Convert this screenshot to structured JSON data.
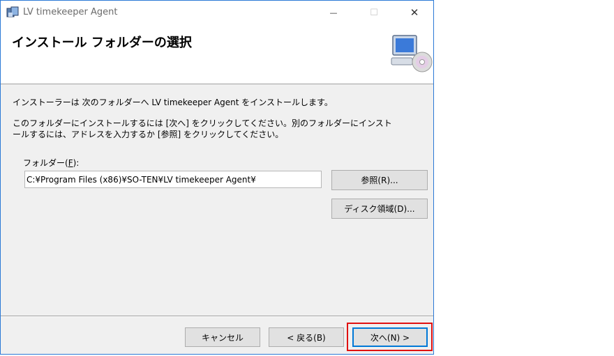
{
  "window": {
    "title": "LV timekeeper Agent",
    "minimize_glyph": "—",
    "maximize_glyph": "☐",
    "close_glyph": "✕"
  },
  "header": {
    "title": "インストール フォルダーの選択",
    "icon": "computer-cd-icon"
  },
  "body": {
    "line1": "インストーラーは 次のフォルダーへ LV timekeeper Agent をインストールします。",
    "line2a": "このフォルダーにインストールするには [次へ] をクリックしてください。別のフォルダーにインスト",
    "line2b": "ールするには、アドレスを入力するか [参照] をクリックしてください。",
    "folder_label_prefix": "フォルダー(",
    "folder_label_key": "F",
    "folder_label_suffix": "):",
    "folder_value": "C:¥Program Files (x86)¥SO-TEN¥LV timekeeper Agent¥",
    "browse_label": "参照(R)...",
    "disk_label": "ディスク領域(D)..."
  },
  "footer": {
    "cancel_label": "キャンセル",
    "back_label": "< 戻る(B)",
    "next_label": "次へ(N) >"
  },
  "colors": {
    "accent_border": "#2b79d6",
    "highlight": "#e01010",
    "default_button_border": "#0078d7"
  }
}
